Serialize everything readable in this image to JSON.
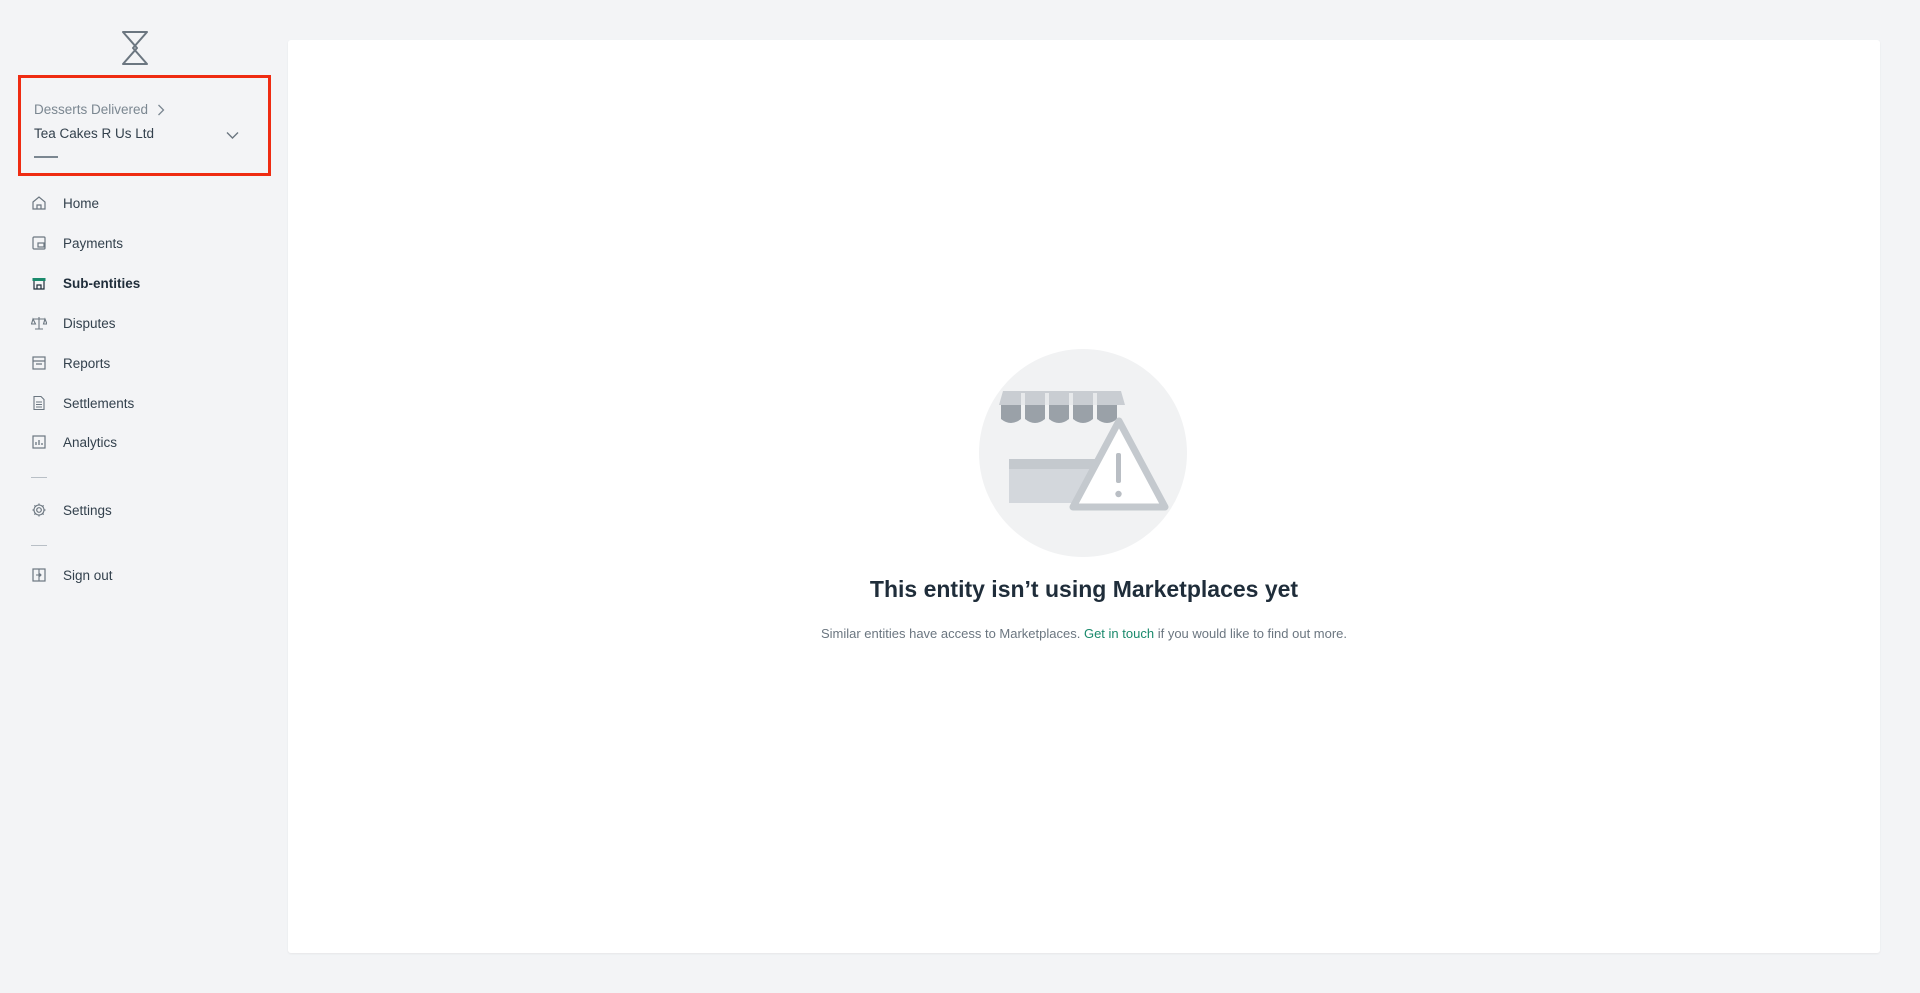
{
  "entity": {
    "parent": "Desserts Delivered",
    "name": "Tea Cakes R Us Ltd"
  },
  "nav": {
    "items": [
      {
        "label": "Home",
        "icon": "home-icon"
      },
      {
        "label": "Payments",
        "icon": "payments-icon"
      },
      {
        "label": "Sub-entities",
        "icon": "store-icon",
        "active": true
      },
      {
        "label": "Disputes",
        "icon": "scales-icon"
      },
      {
        "label": "Reports",
        "icon": "reports-icon"
      },
      {
        "label": "Settlements",
        "icon": "document-icon"
      },
      {
        "label": "Analytics",
        "icon": "analytics-icon"
      },
      {
        "label": "Settings",
        "icon": "gear-icon"
      },
      {
        "label": "Sign out",
        "icon": "sign-out-icon"
      }
    ]
  },
  "empty_state": {
    "title": "This entity isn’t using Marketplaces yet",
    "desc_before": "Similar entities have access to Marketplaces.",
    "link": "Get in touch",
    "desc_after": "if you would like to find out more."
  },
  "colors": {
    "accent": "#1a8a6c",
    "highlight_border": "#ef2c12",
    "background": "#f3f4f6"
  }
}
